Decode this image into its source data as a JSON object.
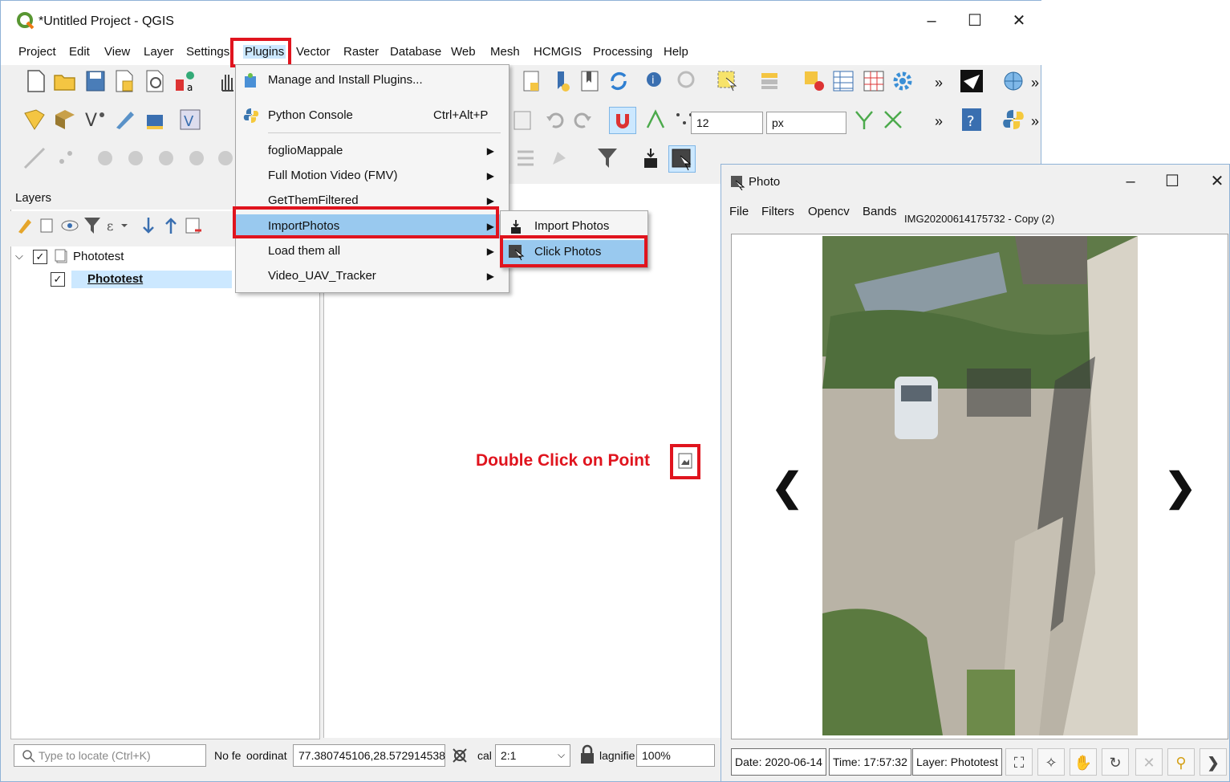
{
  "app": {
    "title": "*Untitled Project - QGIS",
    "window_controls": {
      "minimize": "–",
      "maximize": "☐",
      "close": "✕"
    }
  },
  "menubar": [
    {
      "label": "Project"
    },
    {
      "label": "Edit"
    },
    {
      "label": "View"
    },
    {
      "label": "Layer"
    },
    {
      "label": "Settings"
    },
    {
      "label": "Plugins",
      "active": true
    },
    {
      "label": "Vector"
    },
    {
      "label": "Raster"
    },
    {
      "label": "Database"
    },
    {
      "label": "Web"
    },
    {
      "label": "Mesh"
    },
    {
      "label": "HCMGIS"
    },
    {
      "label": "Processing"
    },
    {
      "label": "Help"
    }
  ],
  "toolbar": {
    "snap_value": "12",
    "snap_unit": "px",
    "overflow": "»"
  },
  "plugins_menu": {
    "manage": "Manage and Install Plugins...",
    "python_console": "Python Console",
    "python_shortcut": "Ctrl+Alt+P",
    "foglio": "foglioMappale",
    "fmv": "Full Motion Video (FMV)",
    "getthem": "GetThemFiltered",
    "importphotos": "ImportPhotos",
    "loadall": "Load them all",
    "uav": "Video_UAV_Tracker"
  },
  "submenu": {
    "import": "Import Photos",
    "click": "Click Photos"
  },
  "layers": {
    "title": "Layers",
    "group": "Phototest",
    "layer": "Phototest"
  },
  "annotation": "Double Click on Point",
  "statusbar": {
    "locate_placeholder": "Type to locate (Ctrl+K)",
    "no_features": "No fe",
    "coord_label": "oordinat",
    "coordinate": "77.380745106,28.572914538",
    "scale_label": "cal",
    "scale": "2:1",
    "magnifier_label": "lagnifie",
    "magnifier": "100%"
  },
  "photo_window": {
    "title": "Photo",
    "menus": [
      "File",
      "Filters",
      "Opencv",
      "Bands"
    ],
    "filename": "IMG20200614175732 - Copy (2)",
    "date": "Date: 2020-06-14",
    "time": "Time: 17:57:32",
    "layer": "Layer: Phototest",
    "prev": "❮",
    "next": "❯"
  },
  "colors": {
    "highlight": "#99c9ef",
    "red": "#e0141e",
    "selected_layer": "#cce8ff"
  }
}
